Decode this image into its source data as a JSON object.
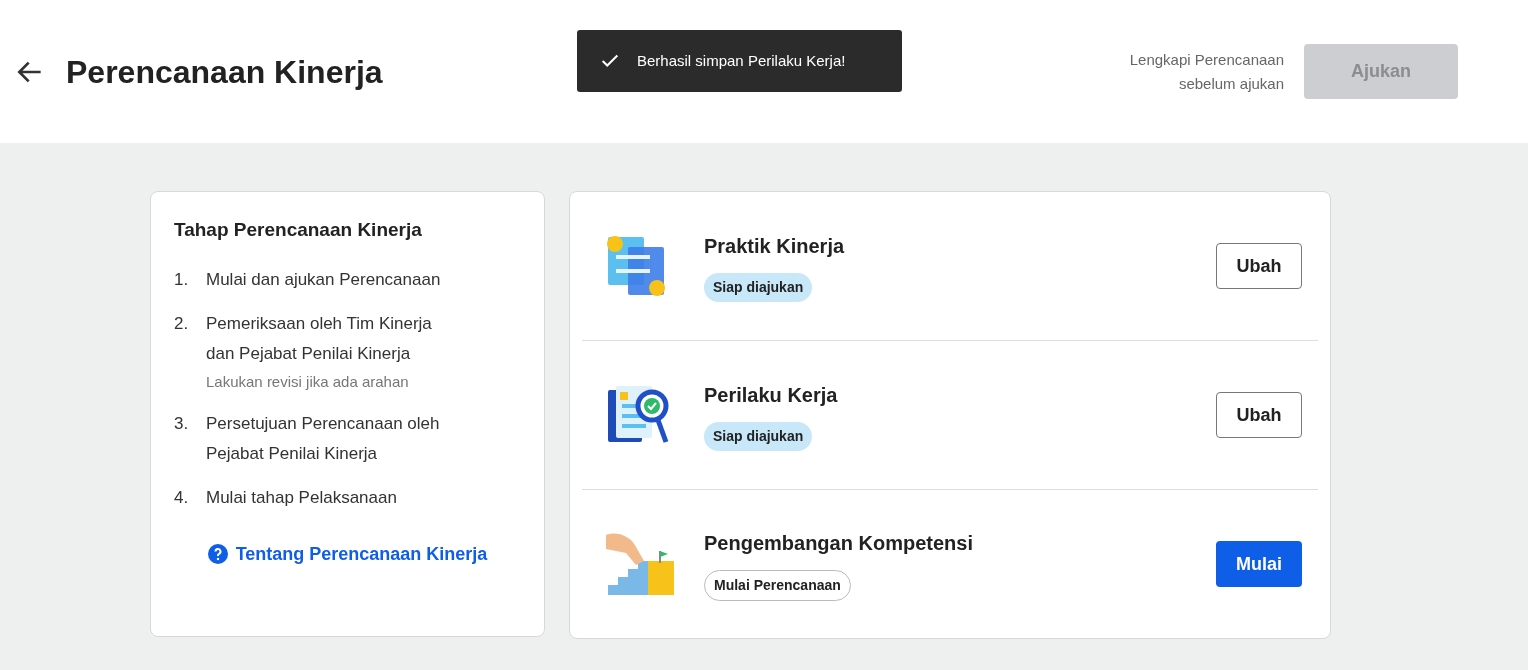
{
  "header": {
    "title": "Perencanaan Kinerja",
    "hint": [
      "Lengkapi Perencanaan",
      "sebelum ajukan"
    ],
    "submit": {
      "label": "Ajukan",
      "disabled": true
    }
  },
  "toast": {
    "message": "Berhasil simpan Perilaku Kerja!"
  },
  "steps_card": {
    "title": "Tahap Perencanaan Kinerja",
    "steps": [
      {
        "number": "1.",
        "lines": [
          "Mulai dan ajukan Perencanaan"
        ]
      },
      {
        "number": "2.",
        "lines": [
          "Pemeriksaan oleh Tim Kinerja",
          "dan Pejabat Penilai Kinerja"
        ],
        "note": "Lakukan revisi jika ada arahan"
      },
      {
        "number": "3.",
        "lines": [
          "Persetujuan Perencanaan oleh",
          "Pejabat Penilai Kinerja"
        ]
      },
      {
        "number": "4.",
        "lines": [
          "Mulai tahap Pelaksanaan"
        ]
      }
    ],
    "link": "Tentang Perencanaan Kinerja"
  },
  "sections": [
    {
      "kind": "swap",
      "title": "Praktik Kinerja",
      "status": {
        "kind": "ready",
        "label": "Siap diajukan"
      },
      "action": {
        "kind": "secondary",
        "label": "Ubah"
      }
    },
    {
      "kind": "review",
      "title": "Perilaku Kerja",
      "status": {
        "kind": "ready",
        "label": "Siap diajukan"
      },
      "action": {
        "kind": "secondary",
        "label": "Ubah"
      }
    },
    {
      "kind": "stairs",
      "title": "Pengembangan Kompetensi",
      "status": {
        "kind": "start",
        "label": "Mulai Perencanaan"
      },
      "action": {
        "kind": "primary",
        "label": "Mulai"
      }
    }
  ]
}
